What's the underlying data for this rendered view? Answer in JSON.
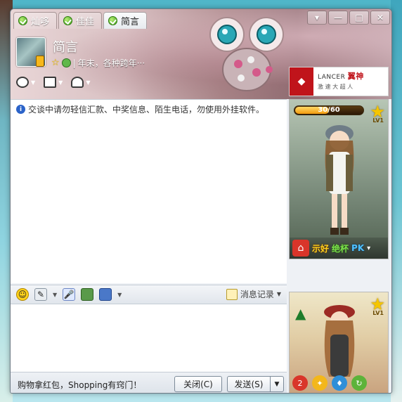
{
  "tabs": [
    {
      "label": "灿哆",
      "active": false
    },
    {
      "label": "佳佳",
      "active": false
    },
    {
      "label": "简言",
      "active": true
    }
  ],
  "window_controls": {
    "menu": "▾",
    "minimize": "—",
    "maximize": "□",
    "close": "✕"
  },
  "contact": {
    "name": "简言",
    "signature": "年末，各种跨年···"
  },
  "toolbar_top": [
    {
      "icon": "video-call-icon"
    },
    {
      "icon": "file-transfer-icon"
    },
    {
      "icon": "app-hat-icon"
    }
  ],
  "ad": {
    "logo_text": "◆",
    "line1": "LANCER",
    "brand": "翼神",
    "line2": "激 速    大 超 人"
  },
  "chat": {
    "notice": "交谈中请勿轻信汇款、中奖信息、陌生电话，勿使用外挂软件。"
  },
  "input_toolbar": {
    "history_label": "消息记录"
  },
  "footer": {
    "promo": "购物拿红包，Shopping有窍门！",
    "close_button": "关闭(C)",
    "send_button": "发送(S)"
  },
  "show_top": {
    "level_current": 30,
    "level_max": 60,
    "level_text": "30/60",
    "level_label": "LV1",
    "actions": [
      "示好",
      "绝杯",
      "PK"
    ]
  },
  "show_bottom": {
    "level_label": "LV1",
    "badge_count": "2"
  },
  "colors": {
    "accent_green": "#3c9f19",
    "brand_red": "#c0141b",
    "window_bg": "#eef1f5"
  }
}
